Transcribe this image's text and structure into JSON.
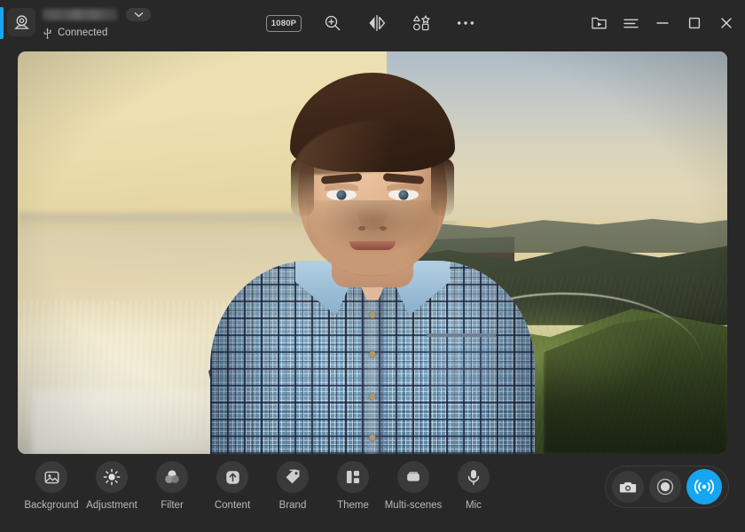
{
  "app": {
    "accent_color": "#16A5F0",
    "chrome_bg": "#282828",
    "panel_bg": "#3a3a3a"
  },
  "titlebar": {
    "device": {
      "icon": "webcam-icon",
      "name_redacted": true,
      "name": "",
      "dropdown_icon": "chevron-down-icon",
      "connection_icon": "usb-icon",
      "connection_status": "Connected"
    },
    "tools": [
      {
        "id": "resolution",
        "icon": "resolution-badge",
        "label": "1080P",
        "type": "badge"
      },
      {
        "id": "zoom",
        "icon": "zoom-in-icon",
        "label": "Zoom",
        "type": "icon"
      },
      {
        "id": "mirror",
        "icon": "mirror-flip-icon",
        "label": "Mirror",
        "type": "icon"
      },
      {
        "id": "stickers",
        "icon": "shapes-stickers-icon",
        "label": "Stickers",
        "type": "icon"
      },
      {
        "id": "more",
        "icon": "more-horizontal-icon",
        "label": "More",
        "type": "icon"
      }
    ],
    "window": [
      {
        "id": "media",
        "icon": "media-folder-icon",
        "label": "Media"
      },
      {
        "id": "menu",
        "icon": "hamburger-menu-icon",
        "label": "Menu"
      },
      {
        "id": "minimize",
        "icon": "minimize-icon",
        "label": "Minimize"
      },
      {
        "id": "maximize",
        "icon": "maximize-icon",
        "label": "Maximize"
      },
      {
        "id": "close",
        "icon": "close-icon",
        "label": "Close"
      }
    ]
  },
  "preview": {
    "name": "camera-preview",
    "description": "Live webcam preview with virtual background: coastal cliffs over a sunlit sea on the left and green rolling hills on the right; a bearded man in a blue plaid button-down shirt is centered.",
    "resolution_badge": "1080P"
  },
  "bottombar": {
    "features": [
      {
        "id": "background",
        "icon": "image-icon",
        "label": "Background"
      },
      {
        "id": "adjustment",
        "icon": "brightness-icon",
        "label": "Adjustment"
      },
      {
        "id": "filter",
        "icon": "color-circles-icon",
        "label": "Filter"
      },
      {
        "id": "content",
        "icon": "upload-arrow-icon",
        "label": "Content"
      },
      {
        "id": "brand",
        "icon": "tag-icon",
        "label": "Brand"
      },
      {
        "id": "theme",
        "icon": "layout-blocks-icon",
        "label": "Theme"
      },
      {
        "id": "multi_scenes",
        "icon": "card-stack-icon",
        "label": "Multi-scenes"
      },
      {
        "id": "mic",
        "icon": "microphone-icon",
        "label": "Mic"
      }
    ],
    "actions": [
      {
        "id": "snapshot",
        "icon": "camera-icon",
        "label": "Snapshot",
        "active": false
      },
      {
        "id": "record",
        "icon": "record-dot-icon",
        "label": "Record",
        "active": false
      },
      {
        "id": "broadcast",
        "icon": "broadcast-icon",
        "label": "Go Live",
        "active": true
      }
    ]
  }
}
